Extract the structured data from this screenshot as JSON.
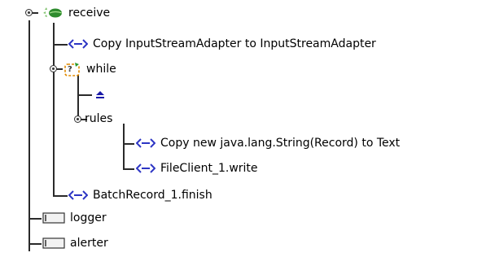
{
  "tree": {
    "receive": {
      "label": "receive",
      "icon": "receive-leaf-icon",
      "children": {
        "copy1": {
          "label": "Copy InputStreamAdapter to InputStreamAdapter",
          "icon": "mapping-arrow-icon"
        },
        "while": {
          "label": "while",
          "icon": "while-loop-icon",
          "children": {
            "eject": {
              "label": "",
              "icon": "eject-icon"
            },
            "rules": {
              "label": "rules",
              "children": {
                "copy2": {
                  "label": "Copy new java.lang.String(Record) to Text",
                  "icon": "mapping-arrow-icon"
                },
                "write": {
                  "label": "FileClient_1.write",
                  "icon": "mapping-arrow-icon"
                }
              }
            }
          }
        },
        "finish": {
          "label": "BatchRecord_1.finish",
          "icon": "mapping-arrow-icon"
        }
      }
    },
    "logger": {
      "label": "logger",
      "icon": "component-box-icon"
    },
    "alerter": {
      "label": "alerter",
      "icon": "component-box-icon"
    }
  },
  "colors": {
    "mapping_icon": "#2d35c4",
    "eject_icon": "#1a1aa8",
    "leaf_green": "#2e8b2e",
    "loop_orange": "#e08a00",
    "tree_lines": "#2a2a2a"
  }
}
